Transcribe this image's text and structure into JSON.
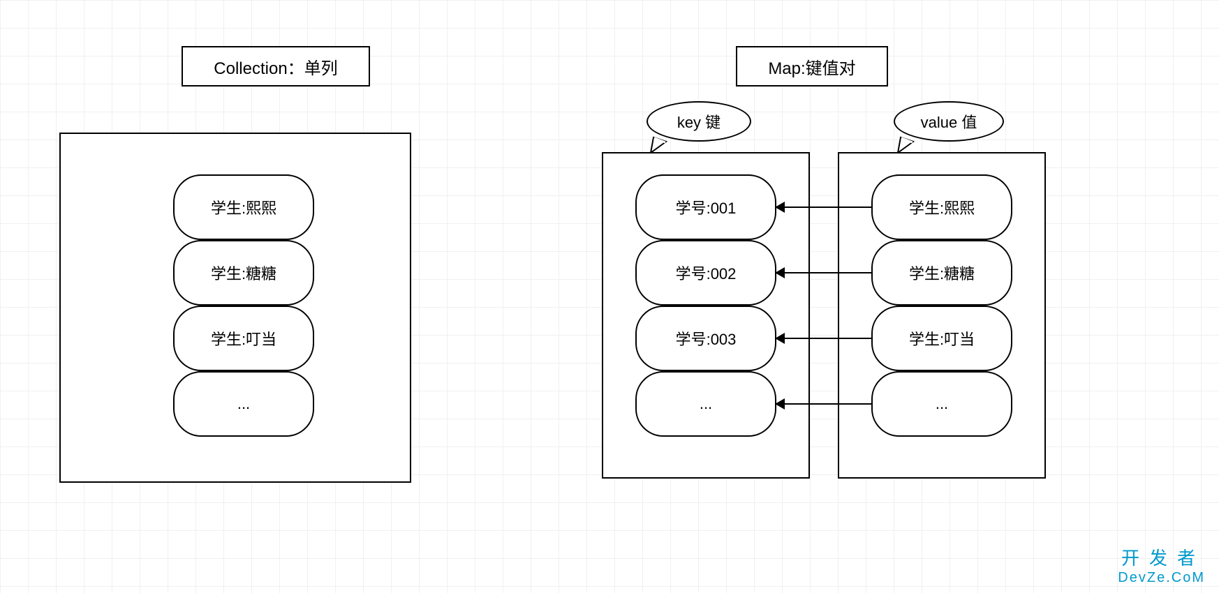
{
  "diagram": {
    "collection": {
      "title": "Collection：单列",
      "items": [
        "学生:熙熙",
        "学生:糖糖",
        "学生:叮当",
        "..."
      ]
    },
    "map": {
      "title": "Map:键值对",
      "key_label": "key 键",
      "value_label": "value 值",
      "keys": [
        "学号:001",
        "学号:002",
        "学号:003",
        "..."
      ],
      "values": [
        "学生:熙熙",
        "学生:糖糖",
        "学生:叮当",
        "..."
      ]
    }
  },
  "watermark": {
    "line1": "开发者",
    "line2": "DevZe.CoM"
  }
}
